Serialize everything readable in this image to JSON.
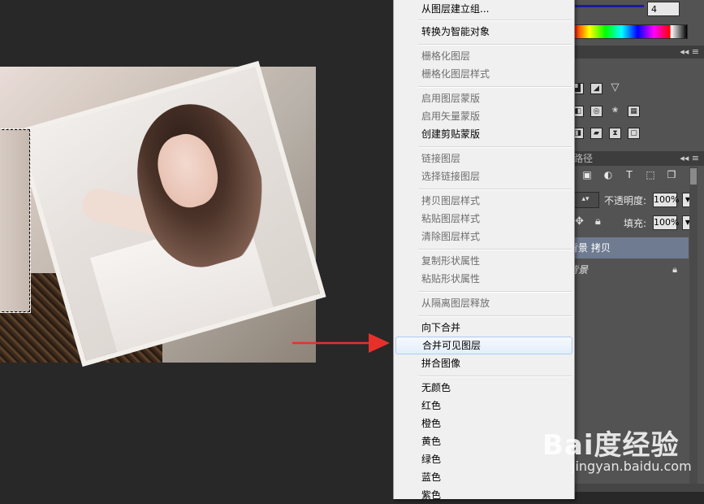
{
  "context_menu": {
    "items": [
      {
        "label": "从图层建立组...",
        "disabled": false
      },
      {
        "label": "转换为智能对象",
        "disabled": false
      },
      {
        "label": "栅格化图层",
        "disabled": true
      },
      {
        "label": "栅格化图层样式",
        "disabled": true
      },
      {
        "label": "启用图层蒙版",
        "disabled": true
      },
      {
        "label": "启用矢量蒙版",
        "disabled": true
      },
      {
        "label": "创建剪贴蒙版",
        "disabled": false
      },
      {
        "label": "链接图层",
        "disabled": true
      },
      {
        "label": "选择链接图层",
        "disabled": true
      },
      {
        "label": "拷贝图层样式",
        "disabled": true
      },
      {
        "label": "粘贴图层样式",
        "disabled": true
      },
      {
        "label": "清除图层样式",
        "disabled": true
      },
      {
        "label": "复制形状属性",
        "disabled": true
      },
      {
        "label": "粘贴形状属性",
        "disabled": true
      },
      {
        "label": "从隔离图层释放",
        "disabled": true
      },
      {
        "label": "向下合并",
        "disabled": false
      },
      {
        "label": "合并可见图层",
        "disabled": false,
        "highlighted": true
      },
      {
        "label": "拼合图像",
        "disabled": false
      },
      {
        "label": "无颜色",
        "disabled": false
      },
      {
        "label": "红色",
        "disabled": false
      },
      {
        "label": "橙色",
        "disabled": false
      },
      {
        "label": "黄色",
        "disabled": false
      },
      {
        "label": "绿色",
        "disabled": false
      },
      {
        "label": "蓝色",
        "disabled": false
      },
      {
        "label": "紫色",
        "disabled": false
      }
    ]
  },
  "color_panel": {
    "value": "4"
  },
  "layers_panel": {
    "tab_label": "路径",
    "opacity_label": "不透明度:",
    "opacity_value": "100%",
    "fill_label": "填充:",
    "fill_value": "100%",
    "layers": [
      {
        "name": "背景 拷贝",
        "selected": true
      },
      {
        "name": "背景",
        "selected": false,
        "locked": true
      }
    ]
  },
  "watermark": {
    "brand": "Bai度经验",
    "url": "jingyan.baidu.com"
  },
  "colors": {
    "menu_bg": "#f0f0f0",
    "menu_highlight_border": "#aecbf1",
    "workspace_bg": "#282828",
    "panel_bg": "#535353",
    "selected_layer": "#6f7b91",
    "arrow": "#e8302b"
  }
}
